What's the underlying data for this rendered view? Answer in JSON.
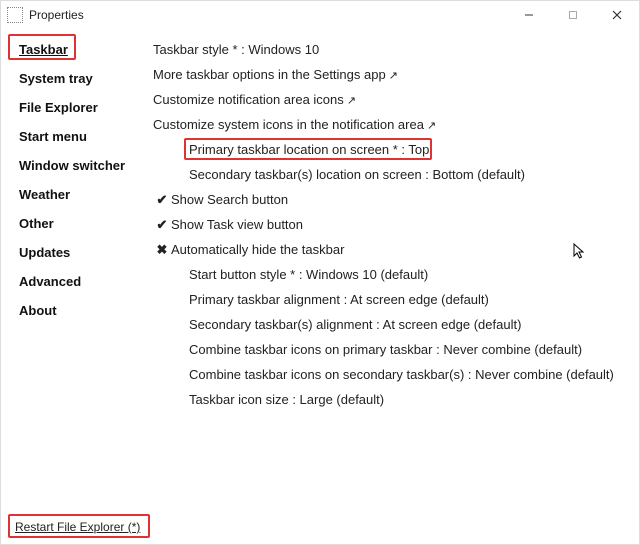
{
  "window": {
    "title": "Properties"
  },
  "sidebar": {
    "items": [
      {
        "label": "Taskbar",
        "selected": true
      },
      {
        "label": "System tray",
        "selected": false
      },
      {
        "label": "File Explorer",
        "selected": false
      },
      {
        "label": "Start menu",
        "selected": false
      },
      {
        "label": "Window switcher",
        "selected": false
      },
      {
        "label": "Weather",
        "selected": false
      },
      {
        "label": "Other",
        "selected": false
      },
      {
        "label": "Updates",
        "selected": false
      },
      {
        "label": "Advanced",
        "selected": false
      },
      {
        "label": "About",
        "selected": false
      }
    ]
  },
  "content": {
    "rows": [
      {
        "text": "Taskbar style * : Windows 10",
        "indent": 0,
        "glyph": "",
        "link": false
      },
      {
        "text": "More taskbar options in the Settings app",
        "indent": 0,
        "glyph": "",
        "link": true
      },
      {
        "text": "Customize notification area icons",
        "indent": 0,
        "glyph": "",
        "link": true
      },
      {
        "text": "Customize system icons in the notification area",
        "indent": 0,
        "glyph": "",
        "link": true
      },
      {
        "text": "Primary taskbar location on screen * : Top",
        "indent": 2,
        "glyph": "",
        "link": false,
        "highlight": true
      },
      {
        "text": "Secondary taskbar(s) location on screen : Bottom (default)",
        "indent": 2,
        "glyph": "",
        "link": false
      },
      {
        "text": "Show Search button",
        "indent": 1,
        "glyph": "check",
        "link": false
      },
      {
        "text": "Show Task view button",
        "indent": 1,
        "glyph": "check",
        "link": false
      },
      {
        "text": "Automatically hide the taskbar",
        "indent": 1,
        "glyph": "cross",
        "link": false
      },
      {
        "text": "Start button style * : Windows 10 (default)",
        "indent": 2,
        "glyph": "",
        "link": false
      },
      {
        "text": "Primary taskbar alignment : At screen edge (default)",
        "indent": 2,
        "glyph": "",
        "link": false
      },
      {
        "text": "Secondary taskbar(s) alignment : At screen edge (default)",
        "indent": 2,
        "glyph": "",
        "link": false
      },
      {
        "text": "Combine taskbar icons on primary taskbar : Never combine (default)",
        "indent": 2,
        "glyph": "",
        "link": false
      },
      {
        "text": "Combine taskbar icons on secondary taskbar(s) : Never combine (default)",
        "indent": 2,
        "glyph": "",
        "link": false
      },
      {
        "text": "Taskbar icon size : Large (default)",
        "indent": 2,
        "glyph": "",
        "link": false
      }
    ]
  },
  "footer": {
    "restart_label": "Restart File Explorer (*)"
  }
}
